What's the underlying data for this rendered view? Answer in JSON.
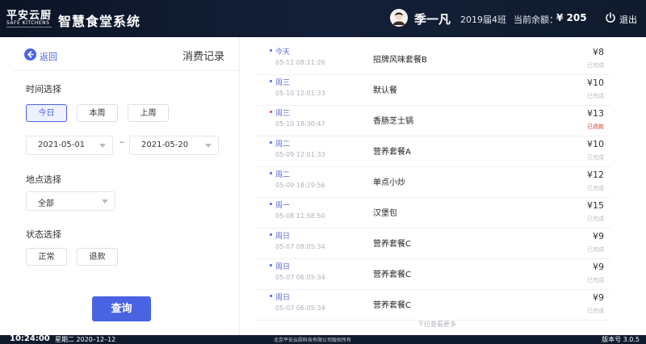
{
  "header": {
    "logo_cn": "平安云厨",
    "logo_en": "SAFE KITCHENS",
    "app_title": "智慧食堂系统",
    "user_name": "季一凡",
    "user_class": "2019届4班",
    "balance_label": "当前余额：",
    "balance_value": "¥ 205",
    "logout_label": "退出"
  },
  "left_panel": {
    "back_label": "返回",
    "title": "消费记录",
    "time_label": "时间选择",
    "time_buttons": [
      "今日",
      "本周",
      "上周"
    ],
    "time_active": "今日",
    "date_start": "2021-05-01",
    "date_end": "2021-05-20",
    "date_separator": "–",
    "location_label": "地点选择",
    "location_value": "全部",
    "status_label": "状态选择",
    "status_buttons": [
      "正常",
      "退款"
    ],
    "query_label": "查询"
  },
  "records": [
    {
      "day": "今天",
      "datetime": "05-11 08:11:26",
      "item": "招牌风味套餐B",
      "amount": "¥8",
      "status": "已完成",
      "refund": false
    },
    {
      "day": "周三",
      "datetime": "05-10 12:01:33",
      "item": "默认餐",
      "amount": "¥10",
      "status": "已完成",
      "refund": false
    },
    {
      "day": "周三",
      "datetime": "05-10 18:30:47",
      "item": "香肠芝士锅",
      "amount": "¥13",
      "status": "已退款",
      "refund": true
    },
    {
      "day": "周二",
      "datetime": "05-09 12:01:33",
      "item": "营养套餐A",
      "amount": "¥10",
      "status": "已完成",
      "refund": false
    },
    {
      "day": "周二",
      "datetime": "05-09 18:29:56",
      "item": "单点小炒",
      "amount": "¥12",
      "status": "已完成",
      "refund": false
    },
    {
      "day": "周一",
      "datetime": "05-08 11:58:50",
      "item": "汉堡包",
      "amount": "¥15",
      "status": "已完成",
      "refund": false
    },
    {
      "day": "周日",
      "datetime": "05-07 08:05:34",
      "item": "营养套餐C",
      "amount": "¥9",
      "status": "已完成",
      "refund": false
    },
    {
      "day": "周日",
      "datetime": "05-07 06:05:34",
      "item": "营养套餐C",
      "amount": "¥9",
      "status": "已完成",
      "refund": false
    },
    {
      "day": "周日",
      "datetime": "05-07 06:05:34",
      "item": "营养套餐C",
      "amount": "¥9",
      "status": "已完成",
      "refund": false
    }
  ],
  "list_more": "下拉查看更多",
  "footer": {
    "time": "10:24:00",
    "date": "星期二  2020–12–12",
    "copyright": "北京平安云厨科技有限公司版权所有",
    "version": "版本号  3.0.5"
  },
  "colors": {
    "header_bg": "#0f1a2d",
    "accent": "#4a63e3",
    "refund": "#e0403a"
  }
}
